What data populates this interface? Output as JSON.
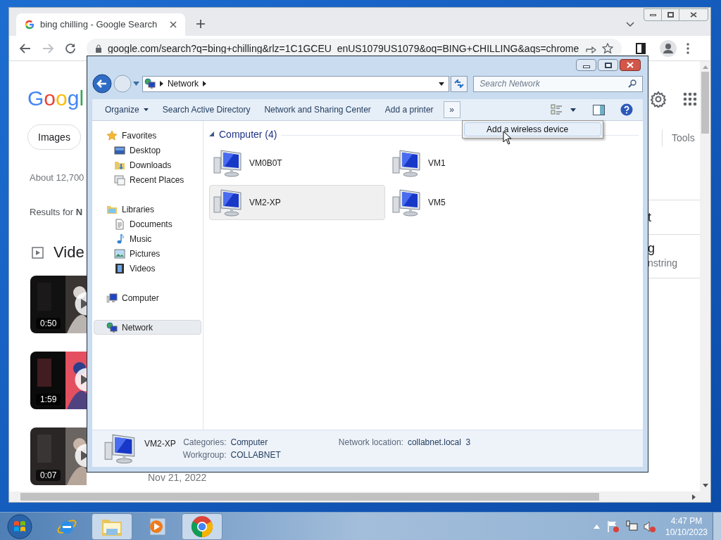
{
  "browser": {
    "tab_title": "bing chilling - Google Search",
    "url": "google.com/search?q=bing+chilling&rlz=1C1GCEU_enUS1079US1079&oq=BING+CHILLING&aqs=chrome",
    "page": {
      "logo": "Googl",
      "chips": [
        "Images"
      ],
      "result_count": "About 12,700",
      "results_for": "Results for **N**",
      "videos_heading": "Vide",
      "videos": [
        {
          "duration": "0:50"
        },
        {
          "duration": "1:59"
        },
        {
          "duration": "0:07"
        }
      ],
      "last_date": "Nov 21, 2022",
      "tools": "Tools",
      "right_fragments": [
        "t",
        "g",
        "nstring"
      ]
    }
  },
  "explorer": {
    "breadcrumb": [
      "Network"
    ],
    "search_placeholder": "Search Network",
    "commands": [
      {
        "label": "Organize",
        "has_menu": true
      },
      {
        "label": "Search Active Directory",
        "has_menu": false
      },
      {
        "label": "Network and Sharing Center",
        "has_menu": false
      },
      {
        "label": "Add a printer",
        "has_menu": false
      }
    ],
    "overflow_button": "»",
    "overflow_menu": [
      "Add a wireless device"
    ],
    "nav": [
      {
        "label": "Favorites",
        "selected": false,
        "children": [
          {
            "label": "Desktop",
            "selected": false
          },
          {
            "label": "Downloads",
            "selected": false
          },
          {
            "label": "Recent Places",
            "selected": false
          }
        ]
      },
      {
        "label": "Libraries",
        "selected": false,
        "children": [
          {
            "label": "Documents",
            "selected": false
          },
          {
            "label": "Music",
            "selected": false
          },
          {
            "label": "Pictures",
            "selected": false
          },
          {
            "label": "Videos",
            "selected": false
          }
        ]
      },
      {
        "label": "Computer",
        "selected": false
      },
      {
        "label": "Network",
        "selected": true
      }
    ],
    "group": {
      "title": "Computer (4)",
      "expanded": true,
      "items": [
        {
          "name": "VM0B0T",
          "selected": false
        },
        {
          "name": "VM1",
          "selected": false
        },
        {
          "name": "VM2-XP",
          "selected": true
        },
        {
          "name": "VM5",
          "selected": false
        }
      ]
    },
    "details": {
      "name": "VM2-XP",
      "fields": [
        {
          "label": "Categories:",
          "value": "Computer"
        },
        {
          "label": "Workgroup:",
          "value": "COLLABNET"
        },
        {
          "label": "Network location:",
          "value": "collabnet.local  3"
        }
      ]
    }
  },
  "taskbar": {
    "apps": [
      {
        "running": false
      },
      {
        "running": true
      },
      {
        "running": false
      },
      {
        "running": true
      }
    ],
    "clock": {
      "time": "4:47 PM",
      "date": "10/10/2023"
    }
  }
}
